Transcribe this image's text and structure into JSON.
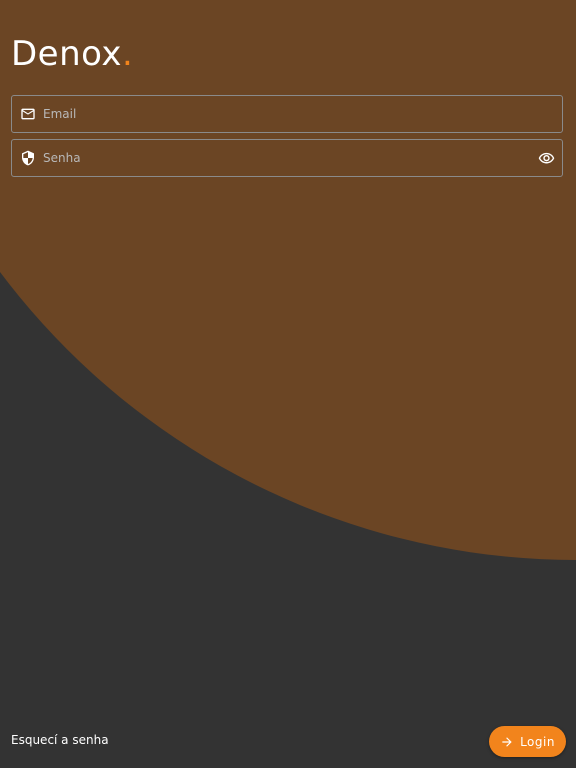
{
  "app": {
    "brand_name": "Denox",
    "brand_dot": "."
  },
  "form": {
    "email_placeholder": "Email",
    "email_icon": "mail-icon",
    "password_placeholder": "Senha",
    "password_icon": "shield-icon",
    "password_toggle_icon": "eye-icon"
  },
  "actions": {
    "forgot_label": "Esquecí a senha",
    "login_label": "Login",
    "login_icon": "arrow-right-icon"
  },
  "colors": {
    "background": "#333333",
    "circle": "#6b4524",
    "accent": "#f2841c"
  }
}
